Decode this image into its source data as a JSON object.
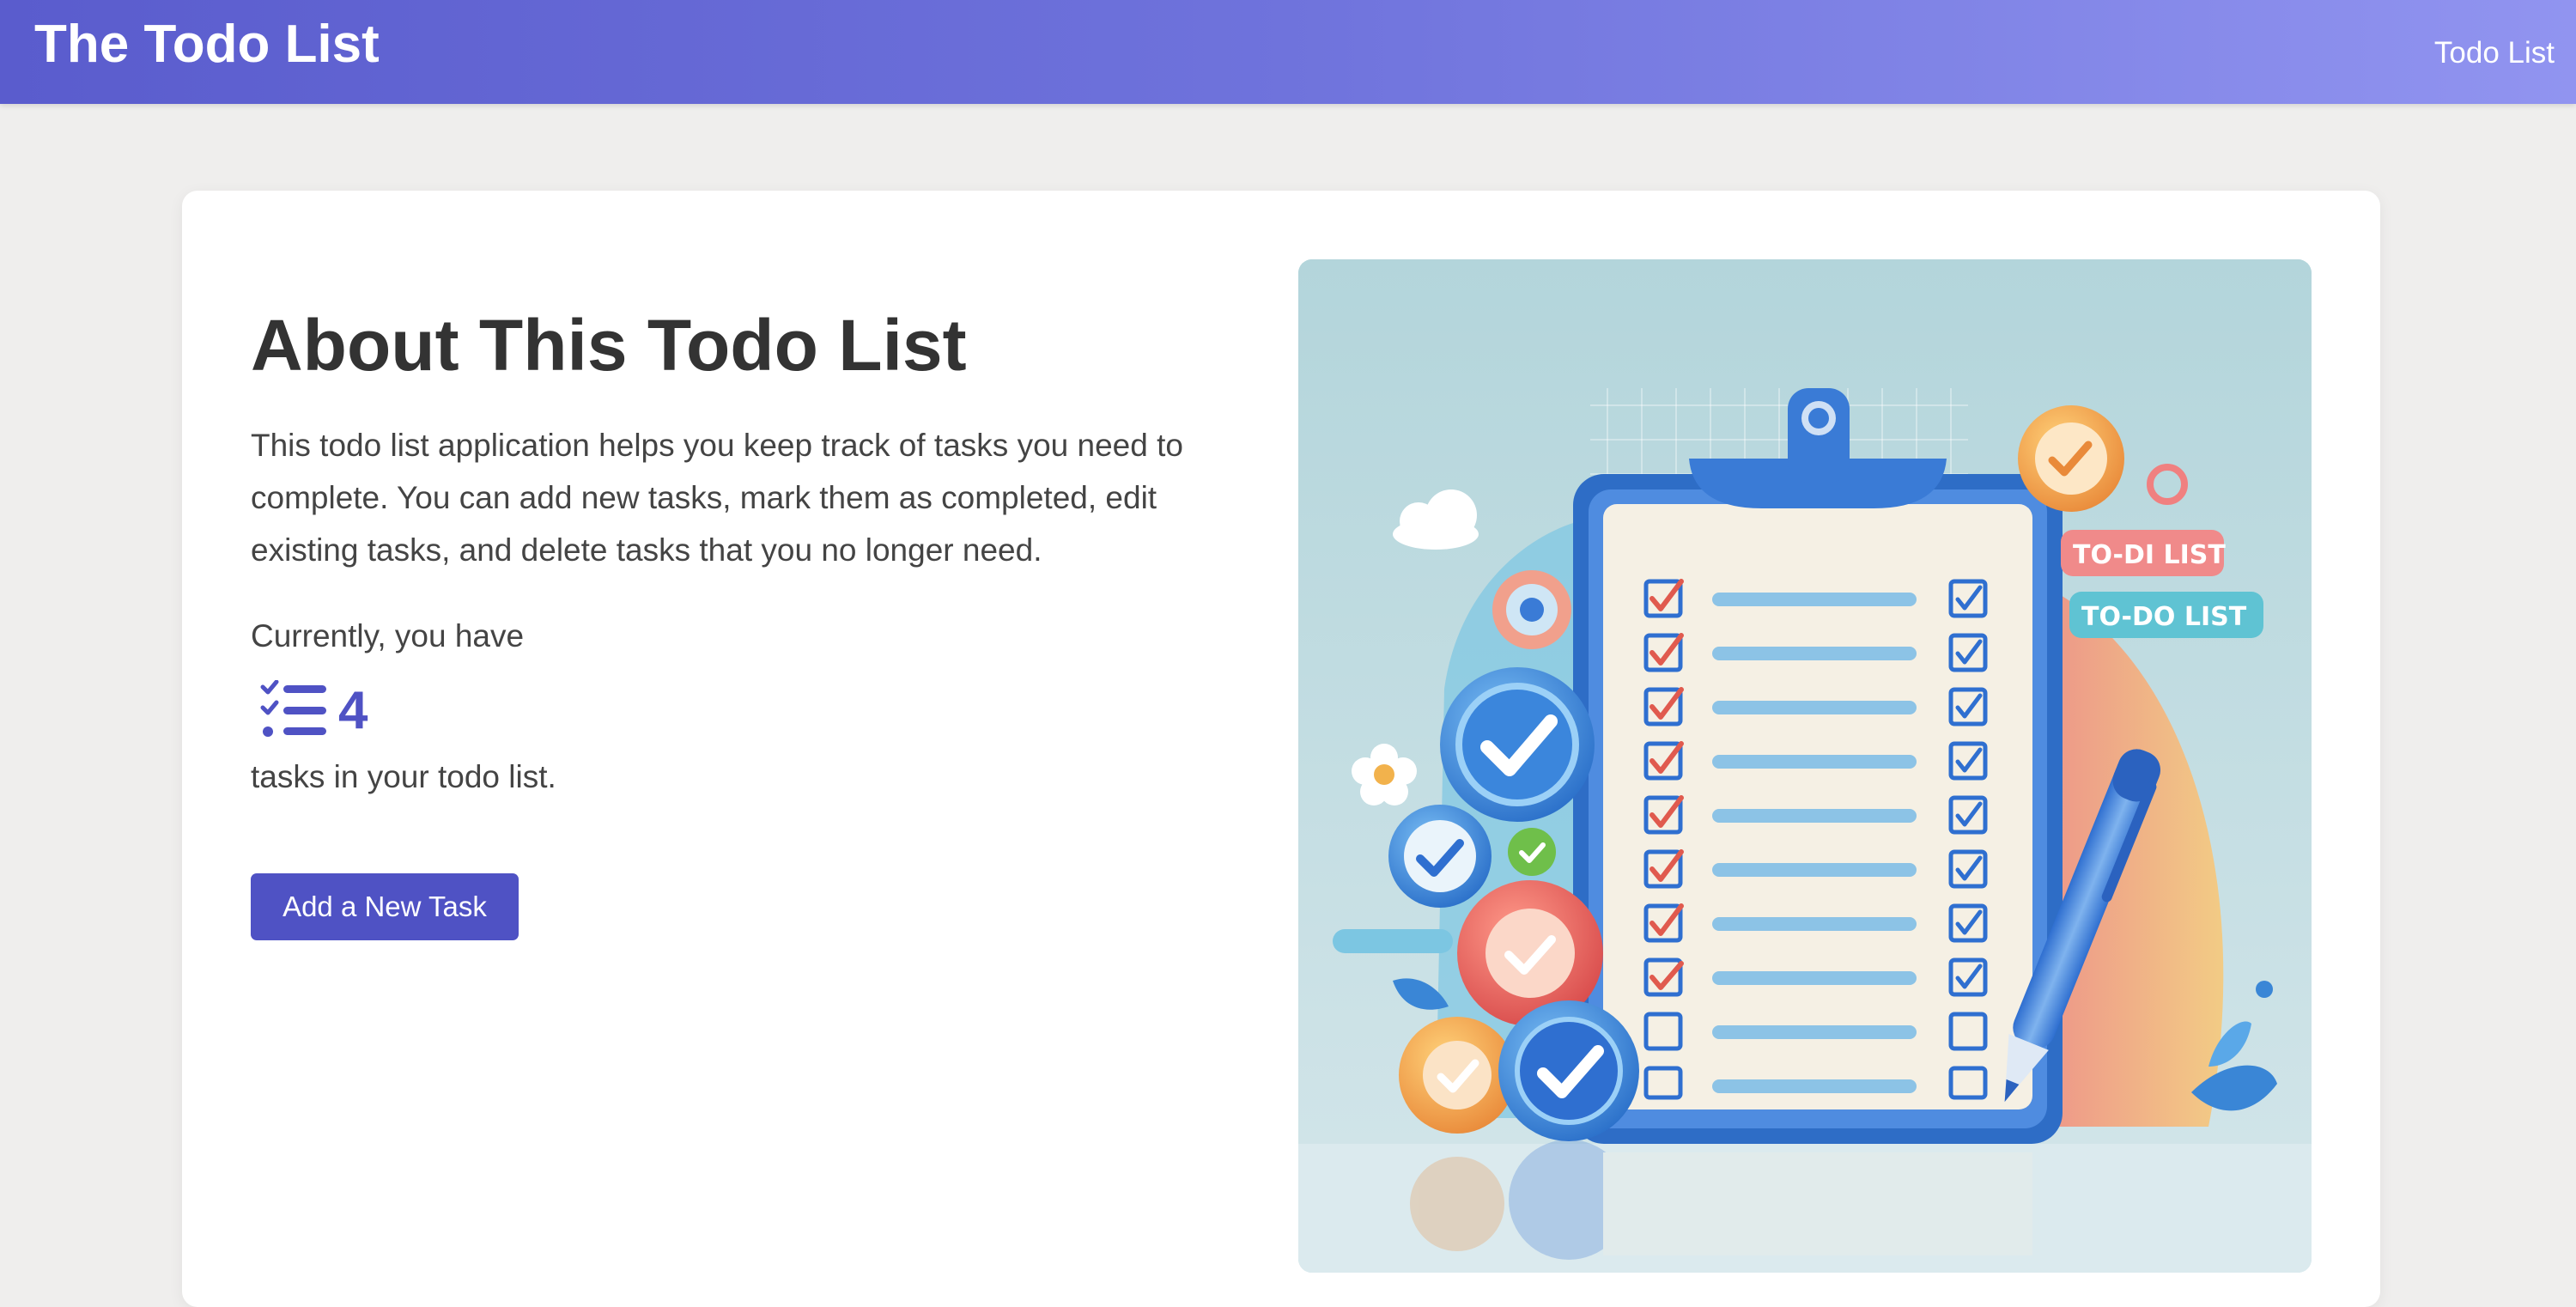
{
  "header": {
    "app_title": "The Todo List",
    "nav_link": "Todo List",
    "gradient_start": "#5a5ccd",
    "gradient_end": "#9194f0"
  },
  "about": {
    "heading": "About This Todo List",
    "description": "This todo list application helps you keep track of tasks you need to complete. You can add new tasks, mark them as completed, edit existing tasks, and delete tasks that you no longer need.",
    "count_lead": "Currently, you have",
    "task_count": "4",
    "count_icon": "list-check-icon",
    "count_tail": "tasks in your todo list.",
    "add_button": "Add a New Task",
    "accent_color": "#4f52c4"
  },
  "illustration": {
    "subject": "clipboard-checklist-illustration",
    "banner_labels": [
      "TO-DI LIST",
      "TO-DO LIST"
    ]
  }
}
